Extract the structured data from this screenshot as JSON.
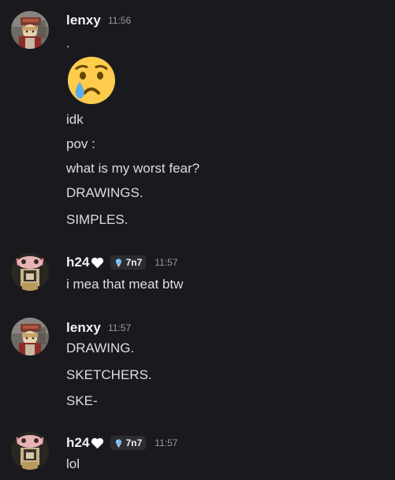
{
  "messages": [
    {
      "author": "lenxy",
      "timestamp": "11:56",
      "lines": [
        ".",
        "idk",
        "pov :",
        "what is my worst fear?",
        "DRAWINGS.",
        "SIMPLES."
      ],
      "emoji": "crying-face"
    },
    {
      "author": "h24",
      "tag": "7n7",
      "timestamp": "11:57",
      "lines": [
        "i mea that meat btw"
      ]
    },
    {
      "author": "lenxy",
      "timestamp": "11:57",
      "lines": [
        "DRAWING.",
        "SKETCHERS.",
        "SKE-"
      ]
    },
    {
      "author": "h24",
      "tag": "7n7",
      "timestamp": "11:57",
      "lines": [
        "lol"
      ]
    }
  ],
  "colors": {
    "background": "#1a1a1e",
    "username": "#f2f3f5",
    "text": "#dbdee1",
    "timestamp": "#949ba4",
    "tag_bg": "#2b2d31"
  }
}
